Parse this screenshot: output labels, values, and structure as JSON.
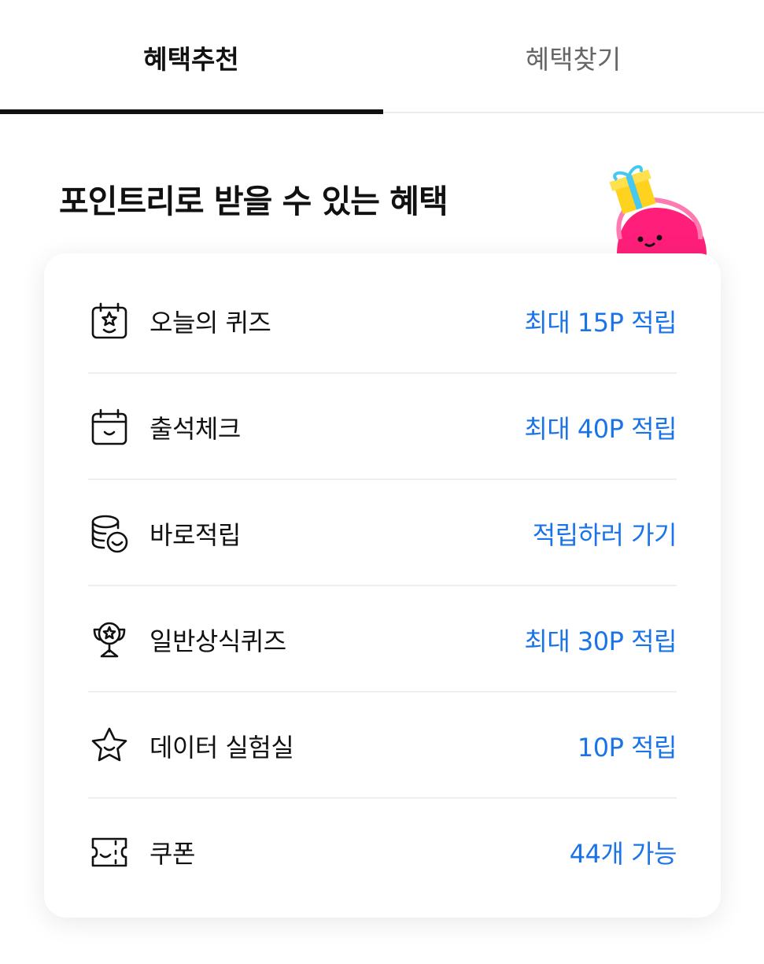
{
  "tabs": {
    "recommend": "혜택추천",
    "find": "혜택찾기"
  },
  "section": {
    "title": "포인트리로 받을 수 있는 혜택"
  },
  "benefits": [
    {
      "label": "오늘의 퀴즈",
      "action": "최대 15P 적립",
      "icon": "calendar-star-icon"
    },
    {
      "label": "출석체크",
      "action": "최대 40P 적립",
      "icon": "calendar-smile-icon"
    },
    {
      "label": "바로적립",
      "action": "적립하러 가기",
      "icon": "coins-smile-icon"
    },
    {
      "label": "일반상식퀴즈",
      "action": "최대 30P 적립",
      "icon": "trophy-icon"
    },
    {
      "label": "데이터 실험실",
      "action": "10P 적립",
      "icon": "star-face-icon"
    },
    {
      "label": "쿠폰",
      "action": "44개 가능",
      "icon": "ticket-icon"
    }
  ],
  "colors": {
    "accent": "#1a74e8",
    "mascot": "#ff1f7a",
    "gift": "#ffd21f"
  }
}
